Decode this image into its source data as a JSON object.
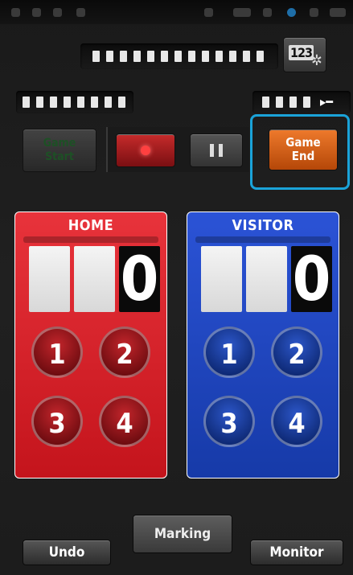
{
  "controls": {
    "game_start_label": "Game\nStart",
    "game_end_label": "Game\nEnd",
    "settings_icon_text": "123"
  },
  "home": {
    "title": "HOME",
    "score": "0",
    "buttons": [
      "1",
      "2",
      "3",
      "4"
    ]
  },
  "visitor": {
    "title": "VISITOR",
    "score": "0",
    "buttons": [
      "1",
      "2",
      "3",
      "4"
    ]
  },
  "bottom": {
    "undo_label": "Undo",
    "marking_label": "Marking",
    "monitor_label": "Monitor"
  },
  "colors": {
    "home": "#d41f27",
    "visitor": "#1f47c4",
    "game_end": "#e8641c",
    "highlight": "#1aa3d9"
  }
}
